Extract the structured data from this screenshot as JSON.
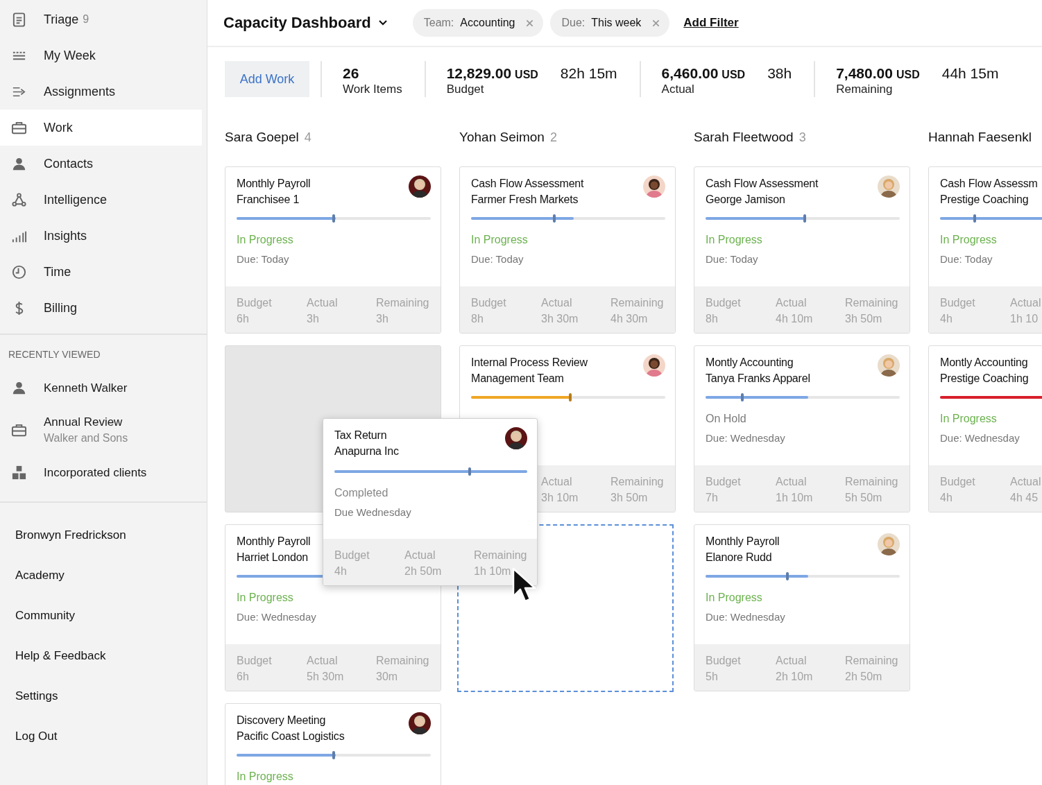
{
  "sidebar": {
    "nav": [
      {
        "label": "Triage",
        "count": "9",
        "selected": false
      },
      {
        "label": "My Week",
        "selected": false
      },
      {
        "label": "Assignments",
        "selected": false
      },
      {
        "label": "Work",
        "selected": true
      },
      {
        "label": "Contacts",
        "selected": false
      },
      {
        "label": "Intelligence",
        "selected": false
      },
      {
        "label": "Insights",
        "selected": false
      },
      {
        "label": "Time",
        "selected": false
      },
      {
        "label": "Billing",
        "selected": false
      }
    ],
    "recent_heading": "RECENTLY VIEWED",
    "recent": [
      {
        "title": "Kenneth Walker"
      },
      {
        "title": "Annual Review",
        "subtitle": "Walker and Sons"
      },
      {
        "title": "Incorporated clients"
      }
    ],
    "links": [
      "Bronwyn Fredrickson",
      "Academy",
      "Community",
      "Help & Feedback",
      "Settings",
      "Log Out"
    ]
  },
  "header": {
    "title": "Capacity Dashboard",
    "filters": [
      {
        "label": "Team:",
        "value": "Accounting"
      },
      {
        "label": "Due:",
        "value": "This week"
      }
    ],
    "add_filter": "Add Filter"
  },
  "summary": {
    "add_button": "Add Work",
    "stats": [
      {
        "value": "26",
        "label": "Work Items"
      },
      {
        "value": "12,829.00",
        "unit": "USD",
        "hours": "82h 15m",
        "label": "Budget"
      },
      {
        "value": "6,460.00",
        "unit": "USD",
        "hours": "38h",
        "label": "Actual"
      },
      {
        "value": "7,480.00",
        "unit": "USD",
        "hours": "44h 15m",
        "label": "Remaining"
      }
    ]
  },
  "columns": [
    {
      "name": "Sara Goepel",
      "count": "4",
      "cards": [
        {
          "kind": "card",
          "title": "Monthly Payroll",
          "subtitle": "Franchisee 1",
          "bar": {
            "level": 0.51,
            "color": "#7ea7e4"
          },
          "marker": {
            "level": 0.5
          },
          "status": {
            "text": "In Progress",
            "kind": "active"
          },
          "due": "Due: Today",
          "footer": {
            "budget": {
              "label": "Budget",
              "value": "6h"
            },
            "actual": {
              "label": "Actual",
              "value": "3h"
            },
            "remaining": {
              "label": "Remaining",
              "value": "3h"
            }
          }
        },
        {
          "kind": "placeholder"
        },
        {
          "kind": "card",
          "title": "Monthly Payroll",
          "subtitle": "Harriet London",
          "bar": {
            "level": 0.5,
            "color": "#7ea7e4"
          },
          "status": {
            "text": "In Progress",
            "kind": "active"
          },
          "due": "Due: Wednesday",
          "footer": {
            "budget": {
              "label": "Budget",
              "value": "6h"
            },
            "actual": {
              "label": "Actual",
              "value": "5h 30m"
            },
            "remaining": {
              "label": "Remaining",
              "value": "30m"
            }
          }
        },
        {
          "kind": "card",
          "title": "Discovery Meeting",
          "subtitle": "Pacific Coast Logistics",
          "bar": {
            "level": 0.51,
            "color": "#7ea7e4"
          },
          "marker": {
            "level": 0.5
          },
          "status": {
            "text": "In Progress",
            "kind": "active"
          }
        }
      ]
    },
    {
      "name": "Yohan Seimon",
      "count": "2",
      "cards": [
        {
          "kind": "card",
          "title": "Cash Flow Assessment",
          "subtitle": "Farmer Fresh Markets",
          "bar": {
            "level": 0.53,
            "color": "#7ea7e4"
          },
          "marker": {
            "level": 0.43
          },
          "status": {
            "text": "In Progress",
            "kind": "active"
          },
          "due": "Due: Today",
          "footer": {
            "budget": {
              "label": "Budget",
              "value": "8h"
            },
            "actual": {
              "label": "Actual",
              "value": "3h 30m"
            },
            "remaining": {
              "label": "Remaining",
              "value": "4h 30m"
            }
          }
        },
        {
          "kind": "card",
          "title": "Internal Process Review",
          "subtitle": "Management Team",
          "bar": {
            "level": 0.51,
            "color": "#f0a625"
          },
          "marker": {
            "level": 0.51
          },
          "footer": {
            "actual": {
              "label": "Actual",
              "value": "3h 10m"
            },
            "remaining": {
              "label": "Remaining",
              "value": "3h 50m"
            }
          }
        },
        {
          "kind": "drop_zone"
        }
      ]
    },
    {
      "name": "Sarah Fleetwood",
      "count": "3",
      "cards": [
        {
          "kind": "card",
          "title": "Cash Flow Assessment",
          "subtitle": "George Jamison",
          "bar": {
            "level": 0.51,
            "color": "#7ea7e4"
          },
          "marker": {
            "level": 0.51
          },
          "status": {
            "text": "In Progress",
            "kind": "active"
          },
          "due": "Due: Today",
          "footer": {
            "budget": {
              "label": "Budget",
              "value": "8h"
            },
            "actual": {
              "label": "Actual",
              "value": "4h 10m"
            },
            "remaining": {
              "label": "Remaining",
              "value": "3h 50m"
            }
          }
        },
        {
          "kind": "card",
          "title": "Montly Accounting",
          "subtitle": "Tanya Franks Apparel",
          "bar": {
            "level": 0.53,
            "color": "#7ea7e4"
          },
          "marker": {
            "level": 0.19
          },
          "status": {
            "text": "On Hold",
            "kind": "paused"
          },
          "due": "Due: Wednesday",
          "footer": {
            "budget": {
              "label": "Budget",
              "value": "7h"
            },
            "actual": {
              "label": "Actual",
              "value": "1h 10m"
            },
            "remaining": {
              "label": "Remaining",
              "value": "5h 50m"
            }
          }
        },
        {
          "kind": "card",
          "title": "Monthly Payroll",
          "subtitle": "Elanore Rudd",
          "bar": {
            "level": 0.53,
            "color": "#7ea7e4"
          },
          "marker": {
            "level": 0.42
          },
          "status": {
            "text": "In Progress",
            "kind": "active"
          },
          "due": "Due: Wednesday",
          "footer": {
            "budget": {
              "label": "Budget",
              "value": "5h"
            },
            "actual": {
              "label": "Actual",
              "value": "2h 10m"
            },
            "remaining": {
              "label": "Remaining",
              "value": "2h 50m"
            }
          }
        }
      ]
    },
    {
      "name": "Hannah Faesenkl",
      "cards": [
        {
          "kind": "card",
          "title": "Cash Flow Assessm",
          "subtitle": "Prestige Coaching",
          "bar": {
            "level": 0.6,
            "color": "#7ea7e4"
          },
          "marker": {
            "level": 0.18
          },
          "status": {
            "text": "In Progress",
            "kind": "active"
          },
          "due": "Due: Today",
          "footer": {
            "budget": {
              "label": "Budget",
              "value": "4h"
            },
            "actual": {
              "label": "Actual",
              "value": "1h 10"
            }
          }
        },
        {
          "kind": "card",
          "title": "Montly Accounting",
          "subtitle": "Prestige Coaching",
          "bar": {
            "level": 1,
            "color": "#d81f2a"
          },
          "status": {
            "text": "In Progress",
            "kind": "active"
          },
          "due": "Due: Wednesday",
          "footer": {
            "budget": {
              "label": "Budget",
              "value": "4h"
            },
            "actual": {
              "label": "Actual",
              "value": "4h 45"
            }
          }
        }
      ]
    }
  ],
  "dragged_card": {
    "title": "Tax Return",
    "subtitle": "Anapurna Inc",
    "bar": {
      "level": 1,
      "color": "#7ea7e4"
    },
    "marker": {
      "level": 0.7
    },
    "status": {
      "text": "Completed",
      "kind": "done"
    },
    "due": "Due Wednesday",
    "footer": {
      "budget": {
        "label": "Budget",
        "value": "4h"
      },
      "actual": {
        "label": "Actual",
        "value": "2h 50m"
      },
      "remaining": {
        "label": "Remaining",
        "value": "1h 10m"
      }
    }
  }
}
